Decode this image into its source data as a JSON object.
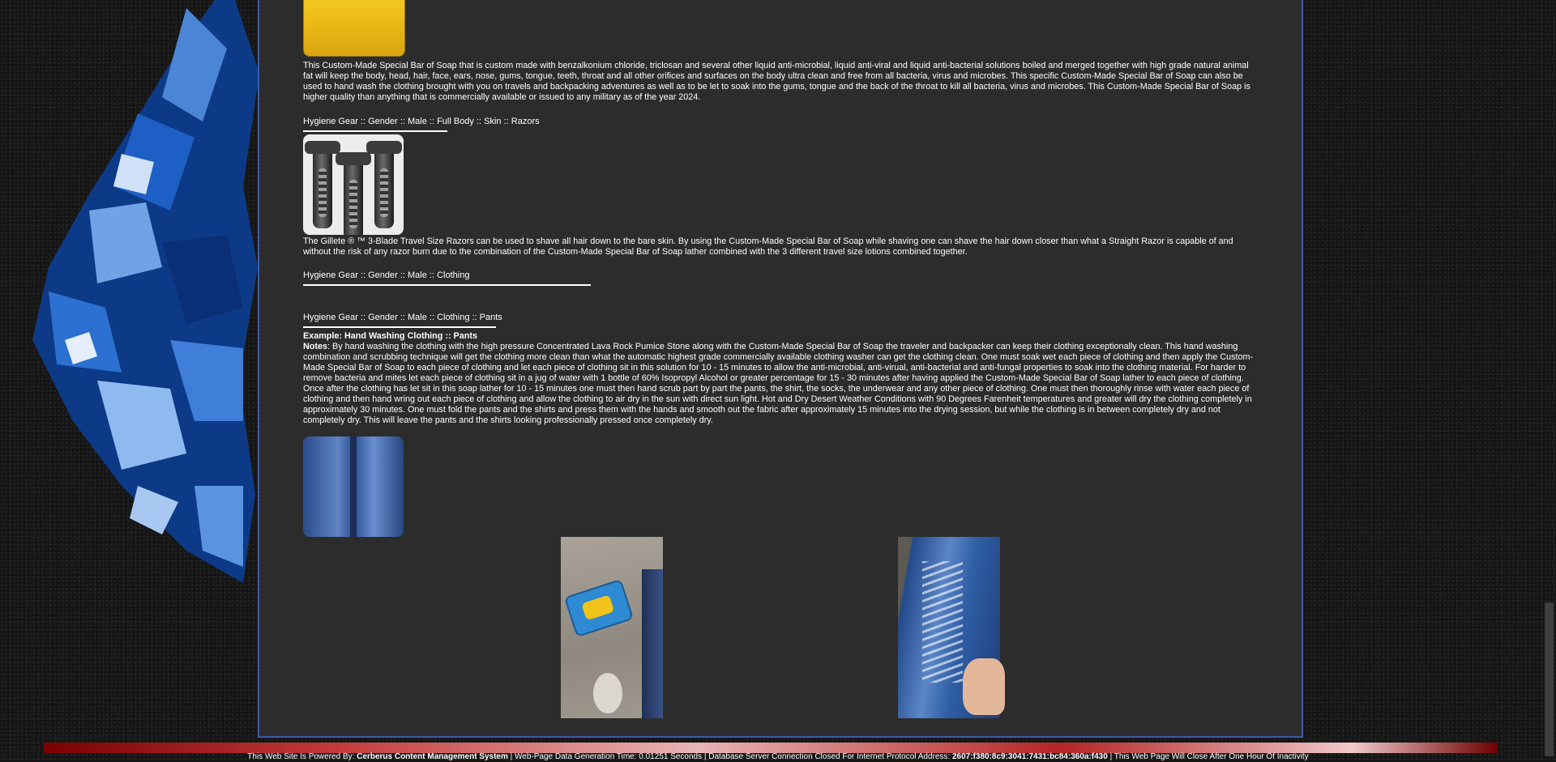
{
  "soap_section": {
    "description": "This Custom-Made Special Bar of Soap that is custom made with benzalkonium chloride, triclosan and several other liquid anti-microbial, liquid anti-viral and liquid anti-bacterial solutions boiled and merged together with high grade natural animal fat will keep the body, head, hair, face, ears, nose, gums, tongue, teeth, throat and all other orifices and surfaces on the body ultra clean and free from all bacteria, virus and microbes. This specific Custom-Made Special Bar of Soap can also be used to hand wash the clothing brought with you on travels and backpacking adventures as well as to be let to soak into the gums, tongue and the back of the throat to kill all bacteria, virus and microbes. This Custom-Made Special Bar of Soap is higher quality than anything that is commercially available or issued to any military as of the year 2024."
  },
  "razors_section": {
    "heading": "Hygiene Gear :: Gender :: Male :: Full Body :: Skin :: Razors",
    "description": "The Gillete ® ™ 3-Blade Travel Size Razors can be used to shave all hair down to the bare skin. By using the Custom-Made Special Bar of Soap while shaving one can shave the hair down closer than what a Straight Razor is capable of and without the risk of any razor burn due to the combination of the Custom-Made Special Bar of Soap lather combined with the 3 different travel size lotions combined together."
  },
  "clothing_section": {
    "heading": "Hygiene Gear :: Gender :: Male :: Clothing"
  },
  "pants_section": {
    "heading": "Hygiene Gear :: Gender :: Male :: Clothing :: Pants",
    "example_label": "Example: Hand Washing Clothing :: Pants",
    "notes_label": "Notes",
    "notes_text": ": By hand washing the clothing with the high pressure Concentrated Lava Rock Pumice Stone along with the Custom-Made Special Bar of Soap the traveler and backpacker can keep their clothing exceptionally clean. This hand washing combination and scrubbing technique will get the clothing more clean than what the automatic highest grade commercially available clothing washer can get the clothing clean. One must soak wet each piece of clothing and then apply the Custom-Made Special Bar of Soap to each piece of clothing and let each piece of clothing sit in this solution for 10 - 15 minutes to allow the anti-microbial, anti-virual, anti-bacterial and anti-fungal properties to soak into the clothing material. For harder to remove bacteria and mites let each piece of clothing sit in a jug of water with 1 bottle of 60% Isopropyl Alcohol or greater percentage for 15 - 30 minutes after having applied the Custom-Made Special Bar of Soap lather to each piece of clothing. Once after the clothing has let sit in this soap lather for 10 - 15 minutes one must then hand scrub part by part the pants, the shirt, the socks, the underwear and any other piece of clothing. One must then thoroughly rinse with water each piece of clothing and then hand wring out each piece of clothing and allow the clothing to air dry in the sun with direct sun light. Hot and Dry Desert Weather Conditions with 90 Degrees Farenheit temperatures and greater will dry the clothing completely in approximately 30 minutes. One must fold the pants and the shirts and press them with the hands and smooth out the fabric after approximately 15 minutes into the drying session, but while the clothing is in between completely dry and not completely dry. This will leave the pants and the shirts looking professionally pressed once completely dry."
  },
  "footer": {
    "powered_prefix": "This Web Site Is Powered By: ",
    "cms_name": "Cerberus Content Management System",
    "generation": " | Web-Page Data Generation Time: 0.01251 Seconds | Database Server Connection Closed For Internet Protocol Address: ",
    "ip": "2607:f380:8c9:3041:7431:bc84:360a:f430",
    "inactivity": " |  This Web Page Will Close After One Hour Of Inactivity"
  },
  "colors": {
    "page_bg": "#151515",
    "panel_bg": "#2c2c2c",
    "panel_border": "#3d5aa8",
    "footer_bar": "#c43a3a"
  }
}
